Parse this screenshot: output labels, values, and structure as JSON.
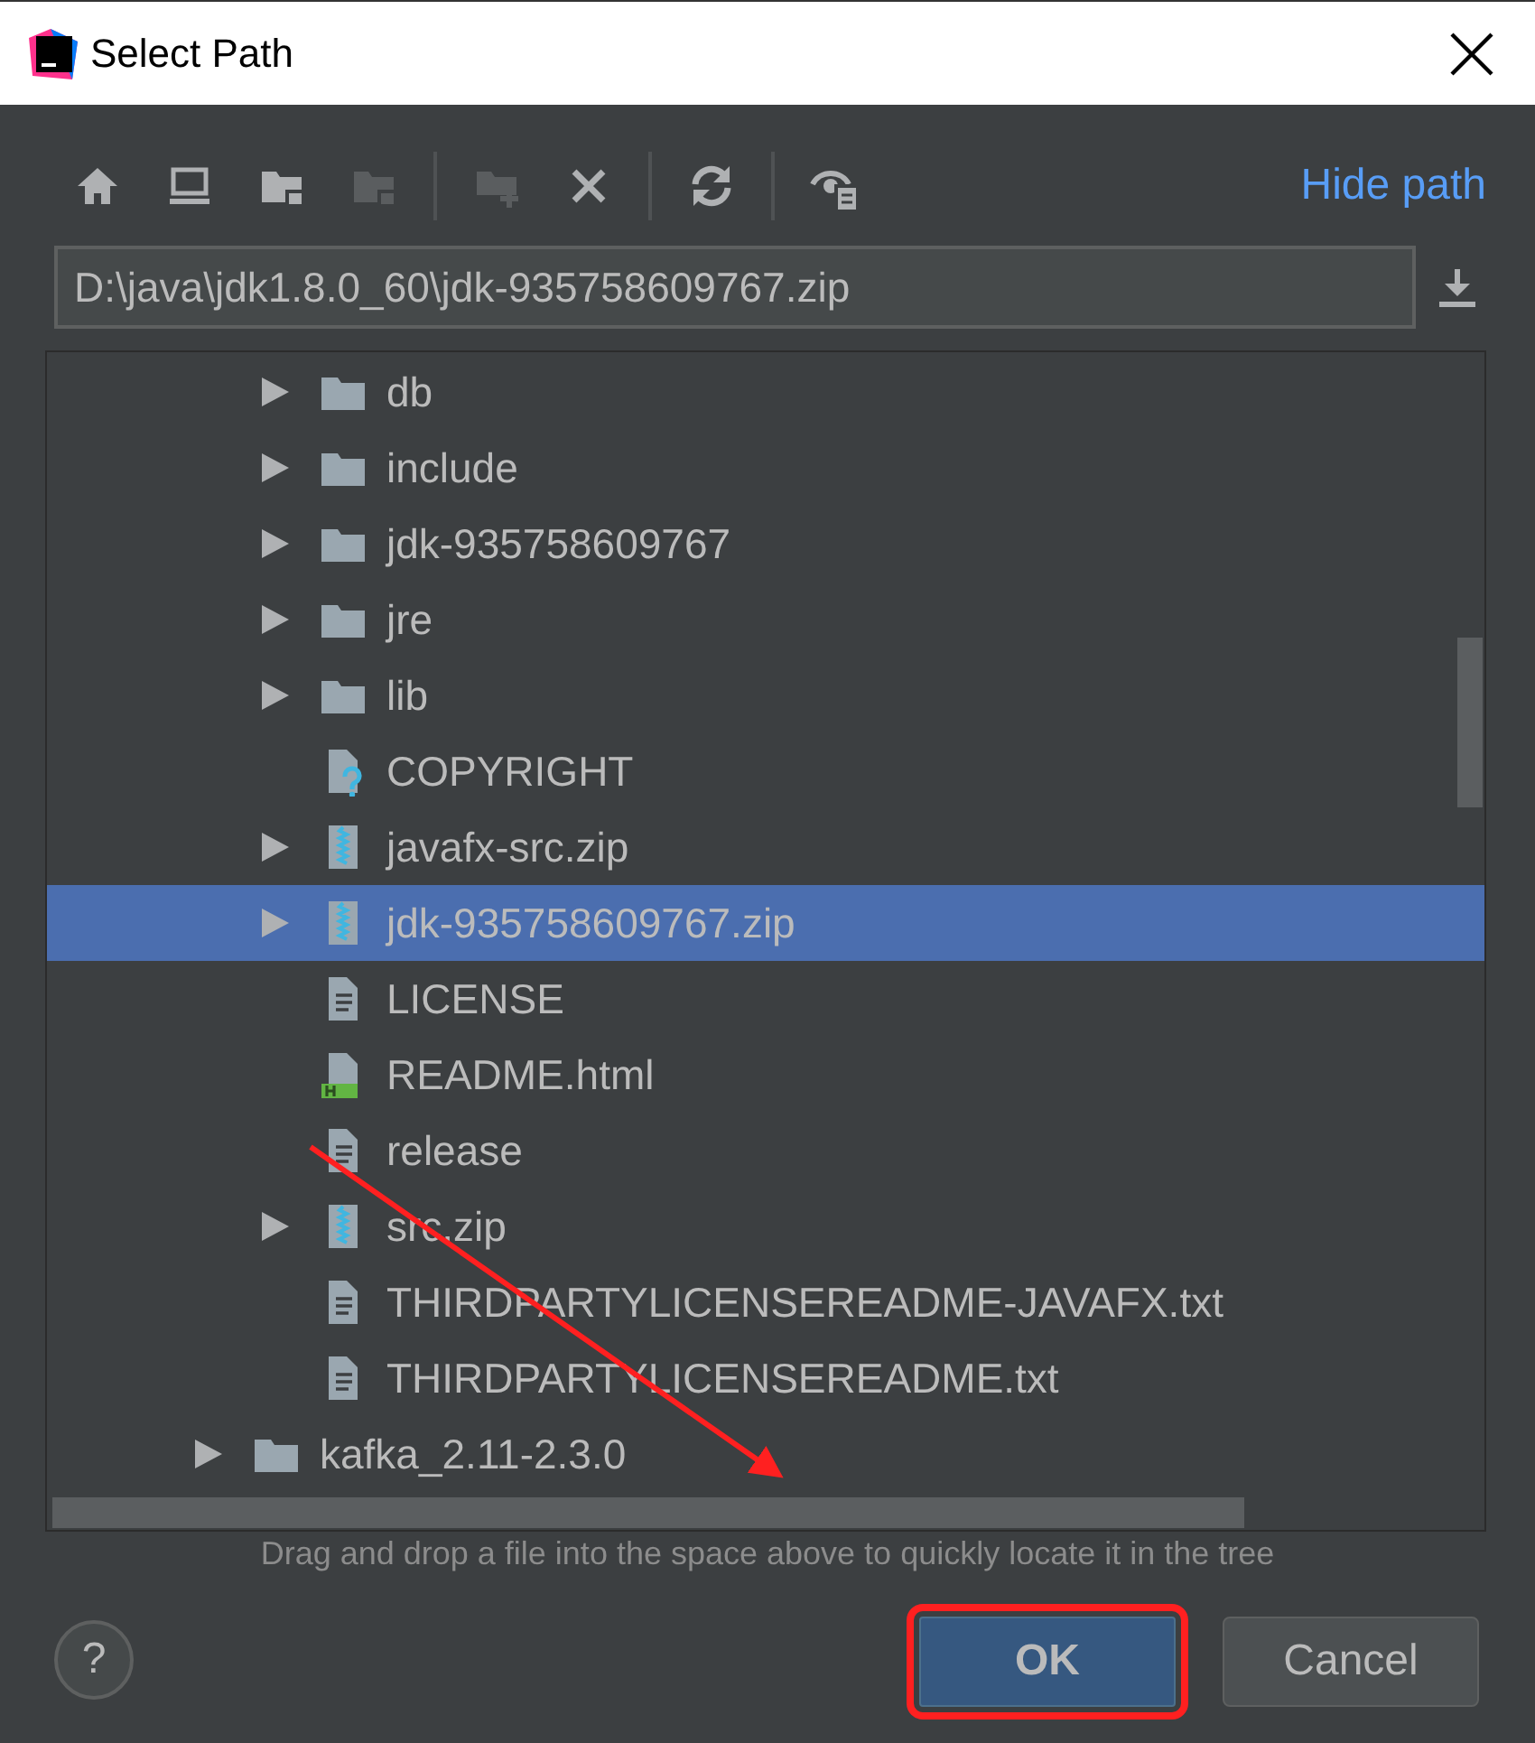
{
  "window": {
    "title": "Select Path"
  },
  "toolbar": [
    {
      "kind": "home",
      "disabled": false
    },
    {
      "kind": "desktop",
      "disabled": false
    },
    {
      "kind": "project-folder",
      "disabled": false
    },
    {
      "kind": "module-folder",
      "disabled": true
    },
    {
      "kind": "separator"
    },
    {
      "kind": "new-folder",
      "disabled": true
    },
    {
      "kind": "delete",
      "disabled": false
    },
    {
      "kind": "separator"
    },
    {
      "kind": "refresh",
      "disabled": false
    },
    {
      "kind": "separator"
    },
    {
      "kind": "show-hidden",
      "disabled": false
    }
  ],
  "hide_path_link": "Hide path",
  "path_field": {
    "value": "D:\\java\\jdk1.8.0_60\\jdk-935758609767.zip"
  },
  "tree": {
    "items": [
      {
        "children": [
          {
            "label": "db",
            "kind": "folder",
            "expandable": true,
            "selected": false
          },
          {
            "label": "include",
            "kind": "folder",
            "expandable": true,
            "selected": false
          },
          {
            "label": "jdk-935758609767",
            "kind": "folder",
            "expandable": true,
            "selected": false
          },
          {
            "label": "jre",
            "kind": "folder",
            "expandable": true,
            "selected": false
          },
          {
            "label": "lib",
            "kind": "folder",
            "expandable": true,
            "selected": false
          },
          {
            "label": "COPYRIGHT",
            "kind": "unknown",
            "expandable": false,
            "selected": false
          },
          {
            "label": "javafx-src.zip",
            "kind": "archive",
            "expandable": true,
            "selected": false
          },
          {
            "label": "jdk-935758609767.zip",
            "kind": "archive",
            "expandable": true,
            "selected": true
          },
          {
            "label": "LICENSE",
            "kind": "text",
            "expandable": false,
            "selected": false
          },
          {
            "label": "README.html",
            "kind": "html",
            "expandable": false,
            "selected": false
          },
          {
            "label": "release",
            "kind": "text",
            "expandable": false,
            "selected": false
          },
          {
            "label": "src.zip",
            "kind": "archive",
            "expandable": true,
            "selected": false
          },
          {
            "label": "THIRDPARTYLICENSEREADME-JAVAFX.txt",
            "kind": "text",
            "expandable": false,
            "selected": false
          },
          {
            "label": "THIRDPARTYLICENSEREADME.txt",
            "kind": "text",
            "expandable": false,
            "selected": false
          }
        ]
      },
      {
        "label": "kafka_2.11-2.3.0",
        "kind": "folder",
        "expandable": true,
        "selected": false
      }
    ]
  },
  "hint": "Drag and drop a file into the space above to quickly locate it in the tree",
  "help_button": {
    "label": "?"
  },
  "buttons": [
    {
      "label": "OK",
      "default": true,
      "highlighted": true
    },
    {
      "label": "Cancel",
      "default": false,
      "highlighted": false
    }
  ]
}
